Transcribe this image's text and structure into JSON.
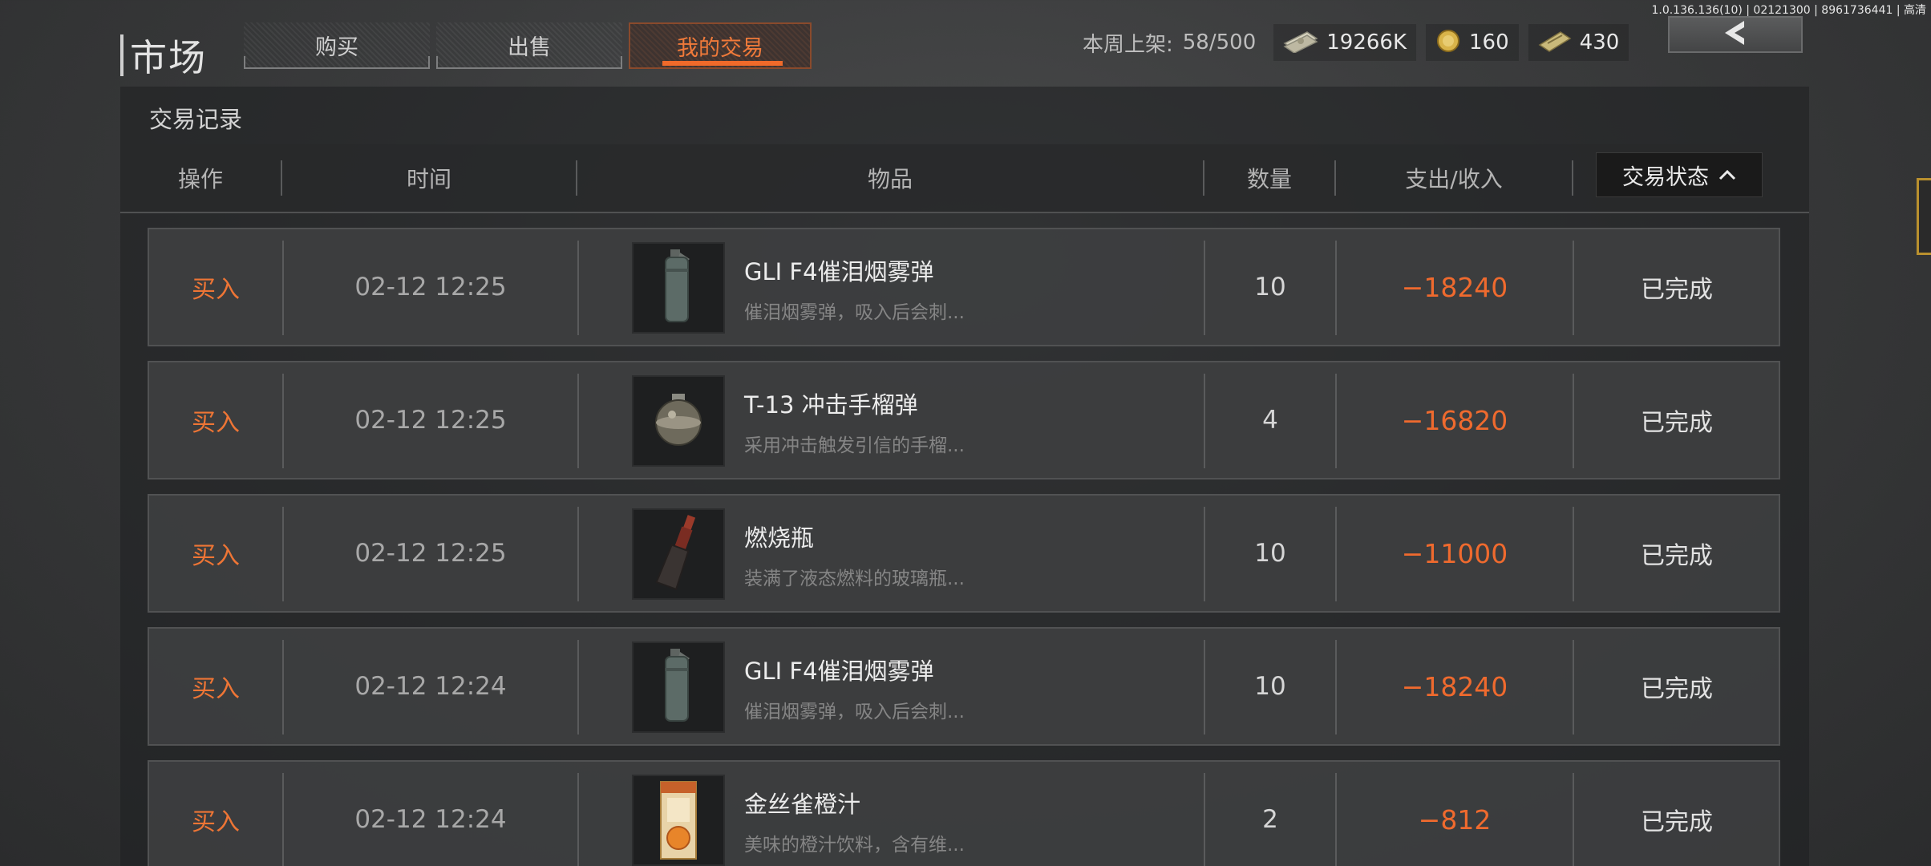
{
  "version": "1.0.136.136(10) | 02121300 | 8961736441 | 高清",
  "header": {
    "title": "市场",
    "tabs": [
      {
        "label": "购买"
      },
      {
        "label": "出售"
      },
      {
        "label": "我的交易"
      }
    ],
    "active_tab": "我的交易",
    "weekly_label": "本周上架:",
    "weekly_value": "58/500",
    "currencies": [
      {
        "icon": "cash-bundle-icon",
        "value": "19266K"
      },
      {
        "icon": "gold-coin-icon",
        "value": "160"
      },
      {
        "icon": "ticket-icon",
        "value": "430"
      }
    ],
    "back_icon": "chevron-left-icon"
  },
  "panel": {
    "section_title": "交易记录",
    "columns": {
      "op": "操作",
      "time": "时间",
      "item": "物品",
      "qty": "数量",
      "amount": "支出/收入",
      "status": "交易状态"
    }
  },
  "rows": [
    {
      "op": "买入",
      "time": "02-12 12:25",
      "name": "GLI F4催泪烟雾弹",
      "desc": "催泪烟雾弹，吸入后会刺...",
      "qty": "10",
      "amount": "−18240",
      "status": "已完成",
      "icon": "smoke-grenade-icon"
    },
    {
      "op": "买入",
      "time": "02-12 12:25",
      "name": "T-13 冲击手榴弹",
      "desc": "采用冲击触发引信的手榴...",
      "qty": "4",
      "amount": "−16820",
      "status": "已完成",
      "icon": "impact-grenade-icon"
    },
    {
      "op": "买入",
      "time": "02-12 12:25",
      "name": "燃烧瓶",
      "desc": "装满了液态燃料的玻璃瓶...",
      "qty": "10",
      "amount": "−11000",
      "status": "已完成",
      "icon": "molotov-icon"
    },
    {
      "op": "买入",
      "time": "02-12 12:24",
      "name": "GLI F4催泪烟雾弹",
      "desc": "催泪烟雾弹，吸入后会刺...",
      "qty": "10",
      "amount": "−18240",
      "status": "已完成",
      "icon": "smoke-grenade-icon"
    },
    {
      "op": "买入",
      "time": "02-12 12:24",
      "name": "金丝雀橙汁",
      "desc": "美味的橙汁饮料，含有维...",
      "qty": "2",
      "amount": "−812",
      "status": "已完成",
      "icon": "orange-juice-icon"
    }
  ],
  "colors": {
    "accent": "#ef6a2e",
    "text": "#d8d8d8"
  }
}
